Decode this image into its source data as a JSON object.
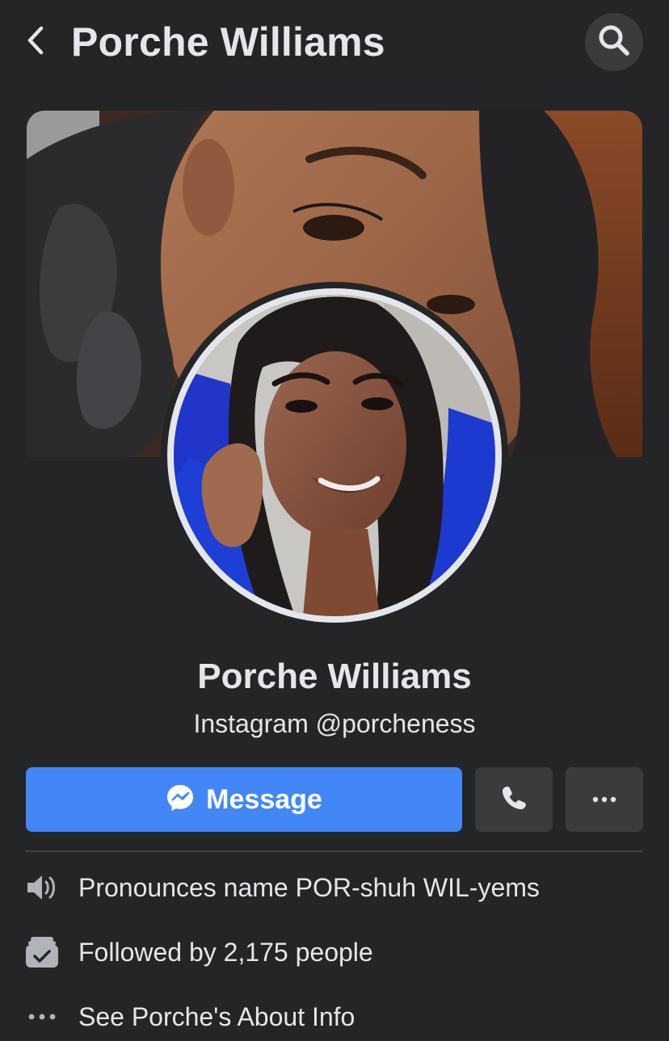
{
  "header": {
    "title": "Porche Williams",
    "back_icon": "chevron-left-icon",
    "search_icon": "search-icon"
  },
  "profile": {
    "name": "Porche Williams",
    "subtitle": "Instagram @porcheness"
  },
  "actions": {
    "message_label": "Message",
    "message_icon": "messenger-icon",
    "call_icon": "phone-icon",
    "more_icon": "more-dots-icon"
  },
  "info": [
    {
      "icon": "speaker-icon",
      "text": "Pronounces name POR-shuh WIL-yems"
    },
    {
      "icon": "followers-icon",
      "text": "Followed by 2,175 people"
    },
    {
      "icon": "more-dots-icon",
      "text": "See Porche's About Info"
    }
  ],
  "colors": {
    "background": "#242526",
    "primary_button": "#4287f5",
    "secondary_button": "#3a3b3c",
    "text": "#e4e6eb"
  }
}
